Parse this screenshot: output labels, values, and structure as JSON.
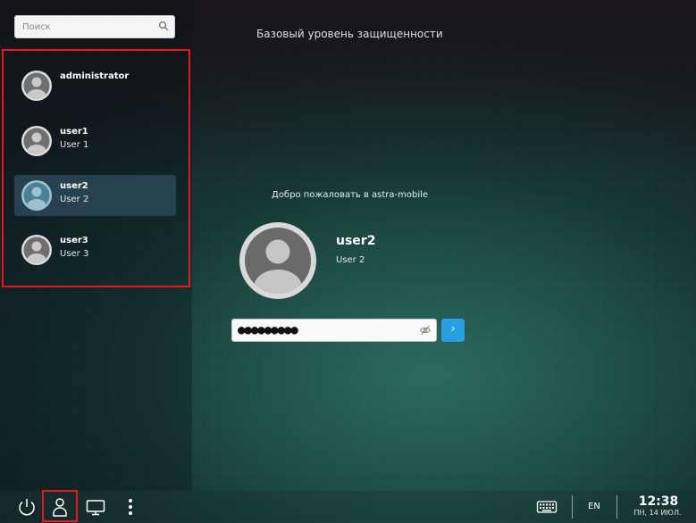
{
  "search": {
    "placeholder": "Поиск",
    "value": ""
  },
  "security_level": "Базовый уровень защищенности",
  "users": [
    {
      "login": "administrator",
      "full_name": "",
      "selected": false
    },
    {
      "login": "user1",
      "full_name": "User 1",
      "selected": false
    },
    {
      "login": "user2",
      "full_name": "User 2",
      "selected": true
    },
    {
      "login": "user3",
      "full_name": "User 3",
      "selected": false
    }
  ],
  "login_panel": {
    "welcome": "Добро пожаловать в astra-mobile",
    "login": "user2",
    "full_name": "User 2",
    "password_value": "●●●●●●●●●",
    "submit_glyph": "›"
  },
  "bottom_bar": {
    "buttons": [
      "power-icon",
      "user-icon",
      "display-icon",
      "more-vertical-icon",
      "keyboard-icon"
    ],
    "language": "EN",
    "time": "12:38",
    "date": "ПН, 14 ИЮЛ."
  },
  "colors": {
    "accent": "#2a9ee3",
    "highlight_frame": "#e8161f",
    "selected_item": "#2a4858"
  }
}
